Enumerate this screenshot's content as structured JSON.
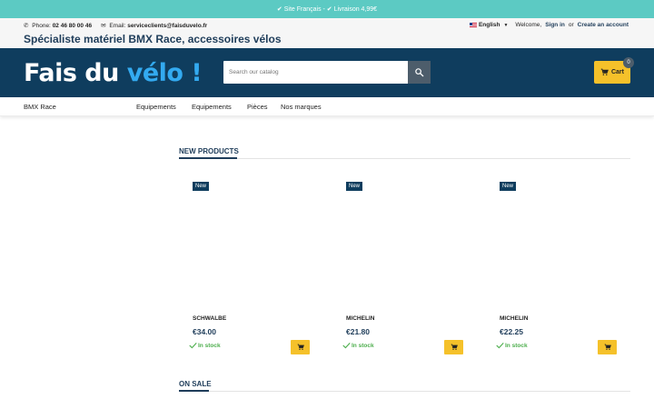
{
  "promo": {
    "text": "✔ Site Français - ✔ Livraison 4,99€"
  },
  "topbar": {
    "phone_label": "Phone:",
    "phone": "02 46 80 00 46",
    "email_label": "Email:",
    "email": "serviceclients@faisduvelo.fr",
    "tagline": "Spécialiste matériel BMX Race, accessoires vélos",
    "language": "English",
    "welcome": "Welcome,",
    "sign_in": "Sign in",
    "or": "or",
    "create_account": "Create an account"
  },
  "header": {
    "logo_part1": "Fais du ",
    "logo_part2": "vélo !",
    "search_placeholder": "Search our catalog",
    "cart_label": "Cart",
    "cart_count": "0"
  },
  "nav": {
    "items": [
      "BMX Race",
      "Equipements",
      "Equipements",
      "Pièces",
      "Nos marques"
    ]
  },
  "sections": {
    "new_products": "NEW PRODUCTS",
    "on_sale": "ON SALE"
  },
  "products": [
    {
      "badge": "New",
      "brand": "SCHWALBE",
      "price": "€34.00",
      "stock": "In stock"
    },
    {
      "badge": "New",
      "brand": "MICHELIN",
      "price": "€21.80",
      "stock": "In stock"
    },
    {
      "badge": "New",
      "brand": "MICHELIN",
      "price": "€22.25",
      "stock": "In stock"
    }
  ],
  "colors": {
    "header_bg": "#0f3d5e",
    "promo_bg": "#5ccac3",
    "accent_yellow": "#f5c12a",
    "logo_highlight": "#33aaf0",
    "stock_green": "#4cae4c"
  },
  "icons": {
    "phone": "phone-icon",
    "email": "mail-icon",
    "search": "search-icon",
    "cart": "cart-icon",
    "check": "check-icon"
  }
}
